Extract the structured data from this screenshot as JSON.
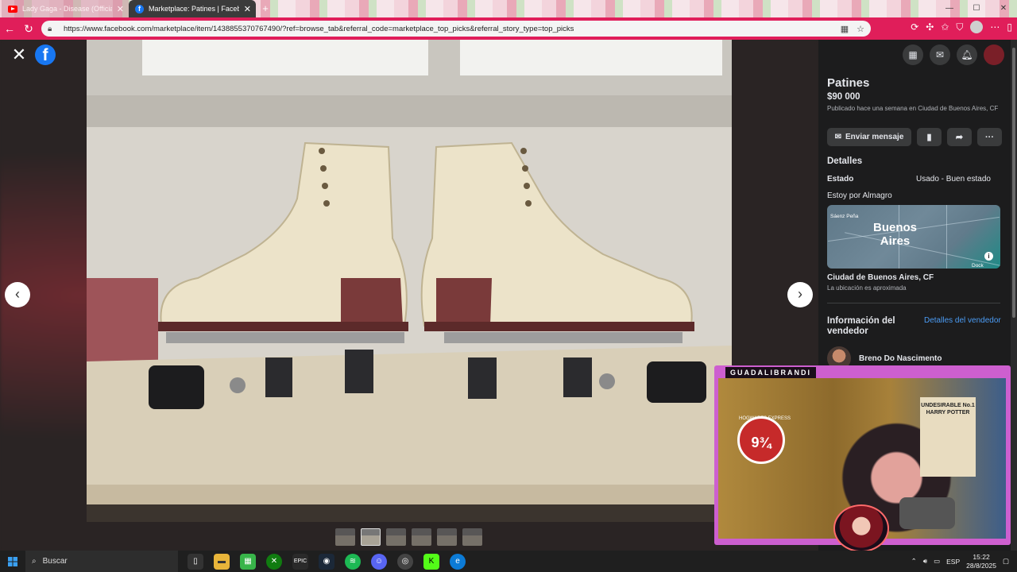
{
  "browser": {
    "tabs": [
      {
        "title": "Lady Gaga - Disease (Officia",
        "icon": "youtube-icon",
        "active": false
      },
      {
        "title": "Marketplace: Patines | Facebook",
        "icon": "facebook-icon",
        "active": true
      }
    ],
    "url": "https://www.facebook.com/marketplace/item/1438855370767490/?ref=browse_tab&referral_code=marketplace_top_picks&referral_story_type=top_picks"
  },
  "viewer": {
    "thumbnail_count": 6,
    "current_index": 2
  },
  "listing": {
    "title": "Patines",
    "price": "$90 000",
    "posted": "Publicado hace una semana en Ciudad de Buenos Aires, CF",
    "send_message_label": "Enviar mensaje",
    "details_heading": "Detalles",
    "condition_label": "Estado",
    "condition_value": "Usado - Buen estado",
    "description": "Estoy por Almagro",
    "map": {
      "city_label_line1": "Buenos",
      "city_label_line2": "Aires",
      "neighborhood_label": "Sáenz Peña",
      "dock_label": "Dock"
    },
    "location": "Ciudad de Buenos Aires, CF",
    "location_note": "La ubicación es aproximada",
    "seller_heading": "Información del vendedor",
    "seller_link": "Detalles del vendedor",
    "seller_name": "Breno Do Nascimento"
  },
  "stream_overlay": {
    "name_plate": "GUADALIBRANDI",
    "poster_left_text": "9¾",
    "poster_left_caption": "HOGWARTS EXPRESS",
    "poster_right_text": "UNDESIRABLE No.1 HARRY POTTER"
  },
  "taskbar": {
    "search_label": "Buscar",
    "language": "ESP",
    "time": "15:22",
    "date": "28/8/2025"
  }
}
